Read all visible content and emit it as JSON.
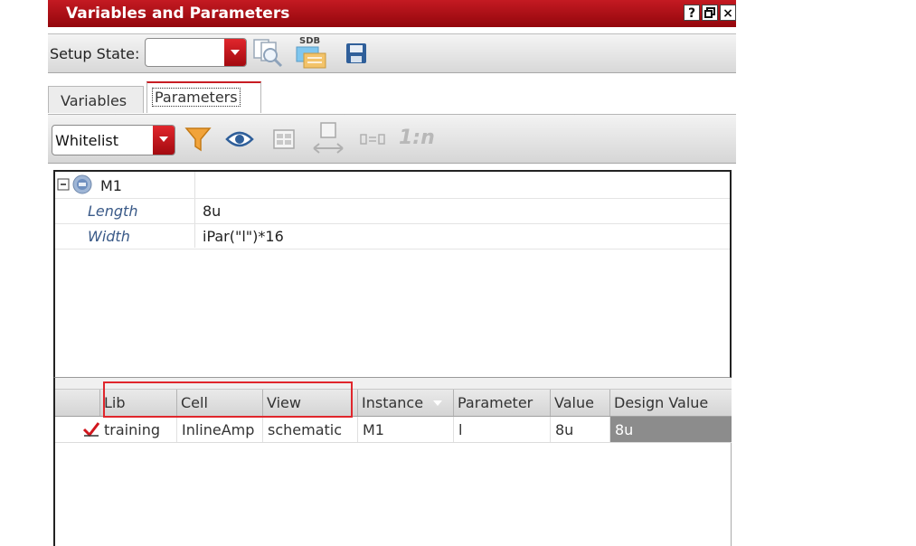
{
  "window": {
    "title": "Variables and Parameters",
    "help_label": "?",
    "restore_label": "\u0001",
    "close_label": "×"
  },
  "setup": {
    "label": "Setup State:",
    "value": "",
    "load_icon": "load-state-icon",
    "sdb_label": "SDB",
    "save_icon": "save-icon"
  },
  "tabs": [
    {
      "label": "Variables",
      "active": false
    },
    {
      "label": "Parameters",
      "active": true
    }
  ],
  "filter": {
    "value": "Whitelist",
    "icons": [
      "filter-icon",
      "eye-icon",
      "table-icon",
      "expand-icon",
      "equal-icon"
    ],
    "ratio_label": "1:n"
  },
  "tree": {
    "instance": "M1",
    "params": [
      {
        "name": "Length",
        "value": "8u"
      },
      {
        "name": "Width",
        "value": "iPar(\"l\")*16"
      }
    ]
  },
  "table": {
    "columns": [
      "Lib",
      "Cell",
      "View",
      "Instance",
      "Parameter",
      "Value",
      "Design Value"
    ],
    "rows": [
      {
        "lib": "training",
        "cell": "InlineAmp",
        "view": "schematic",
        "instance": "M1",
        "parameter": "l",
        "value": "8u",
        "design_value": "8u",
        "checked": true
      }
    ]
  },
  "colors": {
    "accent": "#c41a22",
    "highlight": "#e0262c",
    "param_name": "#3a5a88"
  }
}
